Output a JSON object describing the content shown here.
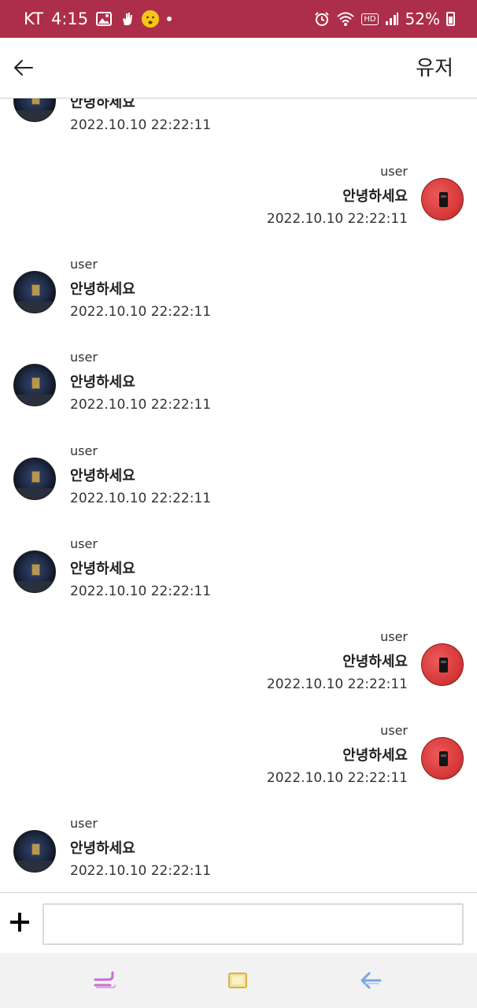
{
  "status_bar": {
    "carrier": "KT",
    "time": "4:15",
    "icons_left": [
      "gallery-icon",
      "hand-icon",
      "worried-face-icon",
      "dot-icon"
    ],
    "icons_right": [
      "alarm-icon",
      "wifi-icon",
      "hd-icon",
      "signal-icon",
      "battery-icon"
    ],
    "hd_label": "HD",
    "battery": "52%",
    "background_color": "#ad2e4a"
  },
  "header": {
    "title": "유저",
    "back_icon": "back-arrow-icon"
  },
  "messages": [
    {
      "side": "left",
      "sender": "",
      "text": "안녕하세요",
      "time": "2022.10.10 22:22:11",
      "avatar": "dark-gallery-avatar"
    },
    {
      "side": "right",
      "sender": "user",
      "text": "안녕하세요",
      "time": "2022.10.10 22:22:11",
      "avatar": "red-avatar"
    },
    {
      "side": "left",
      "sender": "user",
      "text": "안녕하세요",
      "time": "2022.10.10 22:22:11",
      "avatar": "dark-gallery-avatar"
    },
    {
      "side": "left",
      "sender": "user",
      "text": "안녕하세요",
      "time": "2022.10.10 22:22:11",
      "avatar": "dark-gallery-avatar"
    },
    {
      "side": "left",
      "sender": "user",
      "text": "안녕하세요",
      "time": "2022.10.10 22:22:11",
      "avatar": "dark-gallery-avatar"
    },
    {
      "side": "left",
      "sender": "user",
      "text": "안녕하세요",
      "time": "2022.10.10 22:22:11",
      "avatar": "dark-gallery-avatar"
    },
    {
      "side": "right",
      "sender": "user",
      "text": "안녕하세요",
      "time": "2022.10.10 22:22:11",
      "avatar": "red-avatar"
    },
    {
      "side": "right",
      "sender": "user",
      "text": "안녕하세요",
      "time": "2022.10.10 22:22:11",
      "avatar": "red-avatar"
    },
    {
      "side": "left",
      "sender": "user",
      "text": "안녕하세요",
      "time": "2022.10.10 22:22:11",
      "avatar": "dark-gallery-avatar"
    }
  ],
  "input_bar": {
    "add_icon": "plus-icon",
    "input_value": "",
    "input_placeholder": ""
  },
  "nav_bar": {
    "buttons": [
      "recent-apps-icon",
      "home-icon",
      "back-icon"
    ],
    "colors": {
      "recent": "#c76fd0",
      "home": "#e2c86a",
      "back": "#7aa7e0"
    }
  }
}
